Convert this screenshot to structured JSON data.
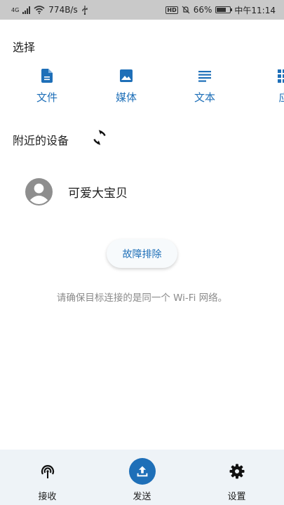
{
  "status_bar": {
    "network": "4G",
    "speed": "774B/s",
    "battery": "66%",
    "time": "中午11:14",
    "hd_label": "HD"
  },
  "select_section": {
    "title": "选择",
    "categories": [
      {
        "label": "文件",
        "icon": "file-icon"
      },
      {
        "label": "媒体",
        "icon": "image-icon"
      },
      {
        "label": "文本",
        "icon": "text-icon"
      },
      {
        "label": "应",
        "icon": "apps-grid-icon"
      }
    ]
  },
  "nearby_section": {
    "title": "附近的设备",
    "refresh_icon": "refresh-icon",
    "devices": [
      {
        "name": "可爱大宝贝",
        "icon": "avatar-icon"
      }
    ]
  },
  "troubleshoot": {
    "label": "故障排除"
  },
  "hint": "请确保目标连接的是同一个 Wi-Fi 网络。",
  "bottom_nav": {
    "items": [
      {
        "label": "接收",
        "icon": "receive-icon",
        "active": false
      },
      {
        "label": "发送",
        "icon": "upload-icon",
        "active": true
      },
      {
        "label": "设置",
        "icon": "gear-icon",
        "active": false
      }
    ]
  },
  "colors": {
    "accent": "#1e6fb8",
    "nav_background": "#eef3f7",
    "status_bar": "#c9c9c9"
  }
}
